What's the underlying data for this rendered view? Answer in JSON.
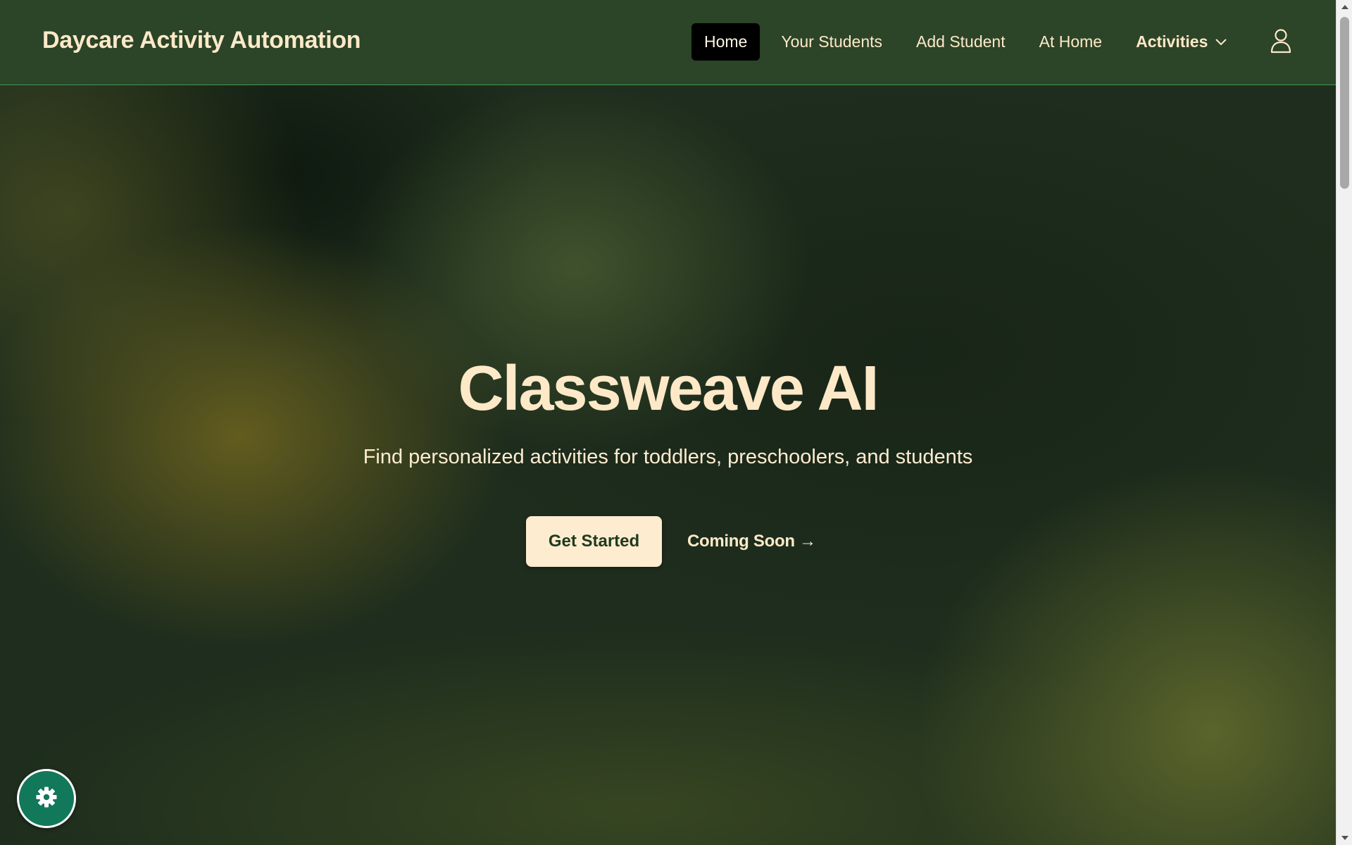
{
  "header": {
    "brand": "Daycare Activity Automation",
    "nav": [
      {
        "label": "Home",
        "active": true
      },
      {
        "label": "Your Students",
        "active": false
      },
      {
        "label": "Add Student",
        "active": false
      },
      {
        "label": "At Home",
        "active": false
      },
      {
        "label": "Activities",
        "active": false,
        "dropdown": true
      }
    ],
    "user_icon": "user-icon"
  },
  "hero": {
    "title": "Classweave AI",
    "subtitle": "Find personalized activities for toddlers, preschoolers, and students",
    "primary_cta": "Get Started",
    "secondary_cta": "Coming Soon →"
  },
  "settings_fab": {
    "icon": "gear-icon"
  },
  "colors": {
    "header_bg": "#2c4428",
    "text_cream": "#fde9c8",
    "active_nav_bg": "#000000",
    "fab_bg": "#12785a",
    "button_bg": "#fdecd0"
  }
}
